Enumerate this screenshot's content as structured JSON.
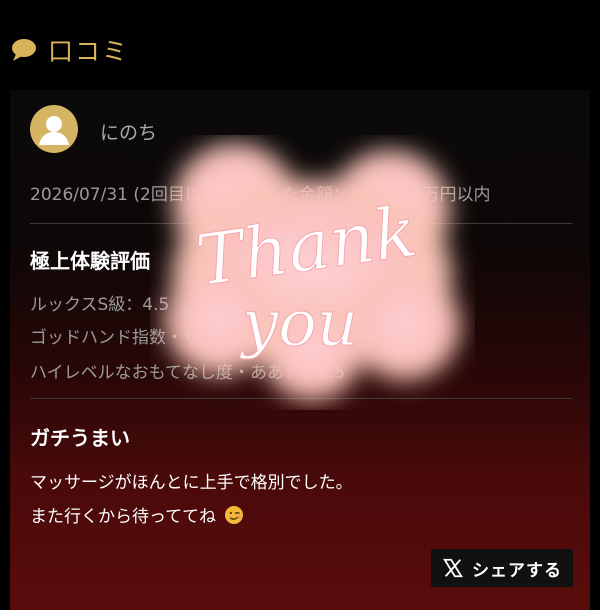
{
  "section": {
    "title": "口コミ",
    "icon": "speech-bubble-icon",
    "accent_color": "#d9b35a"
  },
  "review": {
    "avatar_icon": "user-avatar-icon",
    "user_name": "にのち",
    "meta": "2026/07/31 (2回目以上) 利用した金額：1万円〜2万円以内",
    "rating_title": "極上体験評価",
    "ratings": [
      "ルックスS級：4.5",
      "ゴッドハンド指数・サービス：4.5",
      "ハイレベルなおもてなし度・ああ！：4.5"
    ],
    "comment_title": "ガチうまい",
    "comment_lines": [
      "マッサージがほんとに上手で格別でした。",
      "また行くから待っててね"
    ],
    "emoji_icon": "winking-face-icon"
  },
  "share": {
    "label": "シェアする",
    "icon": "x-logo-icon"
  },
  "sticker": {
    "line1": "Thank",
    "line2": "you"
  }
}
